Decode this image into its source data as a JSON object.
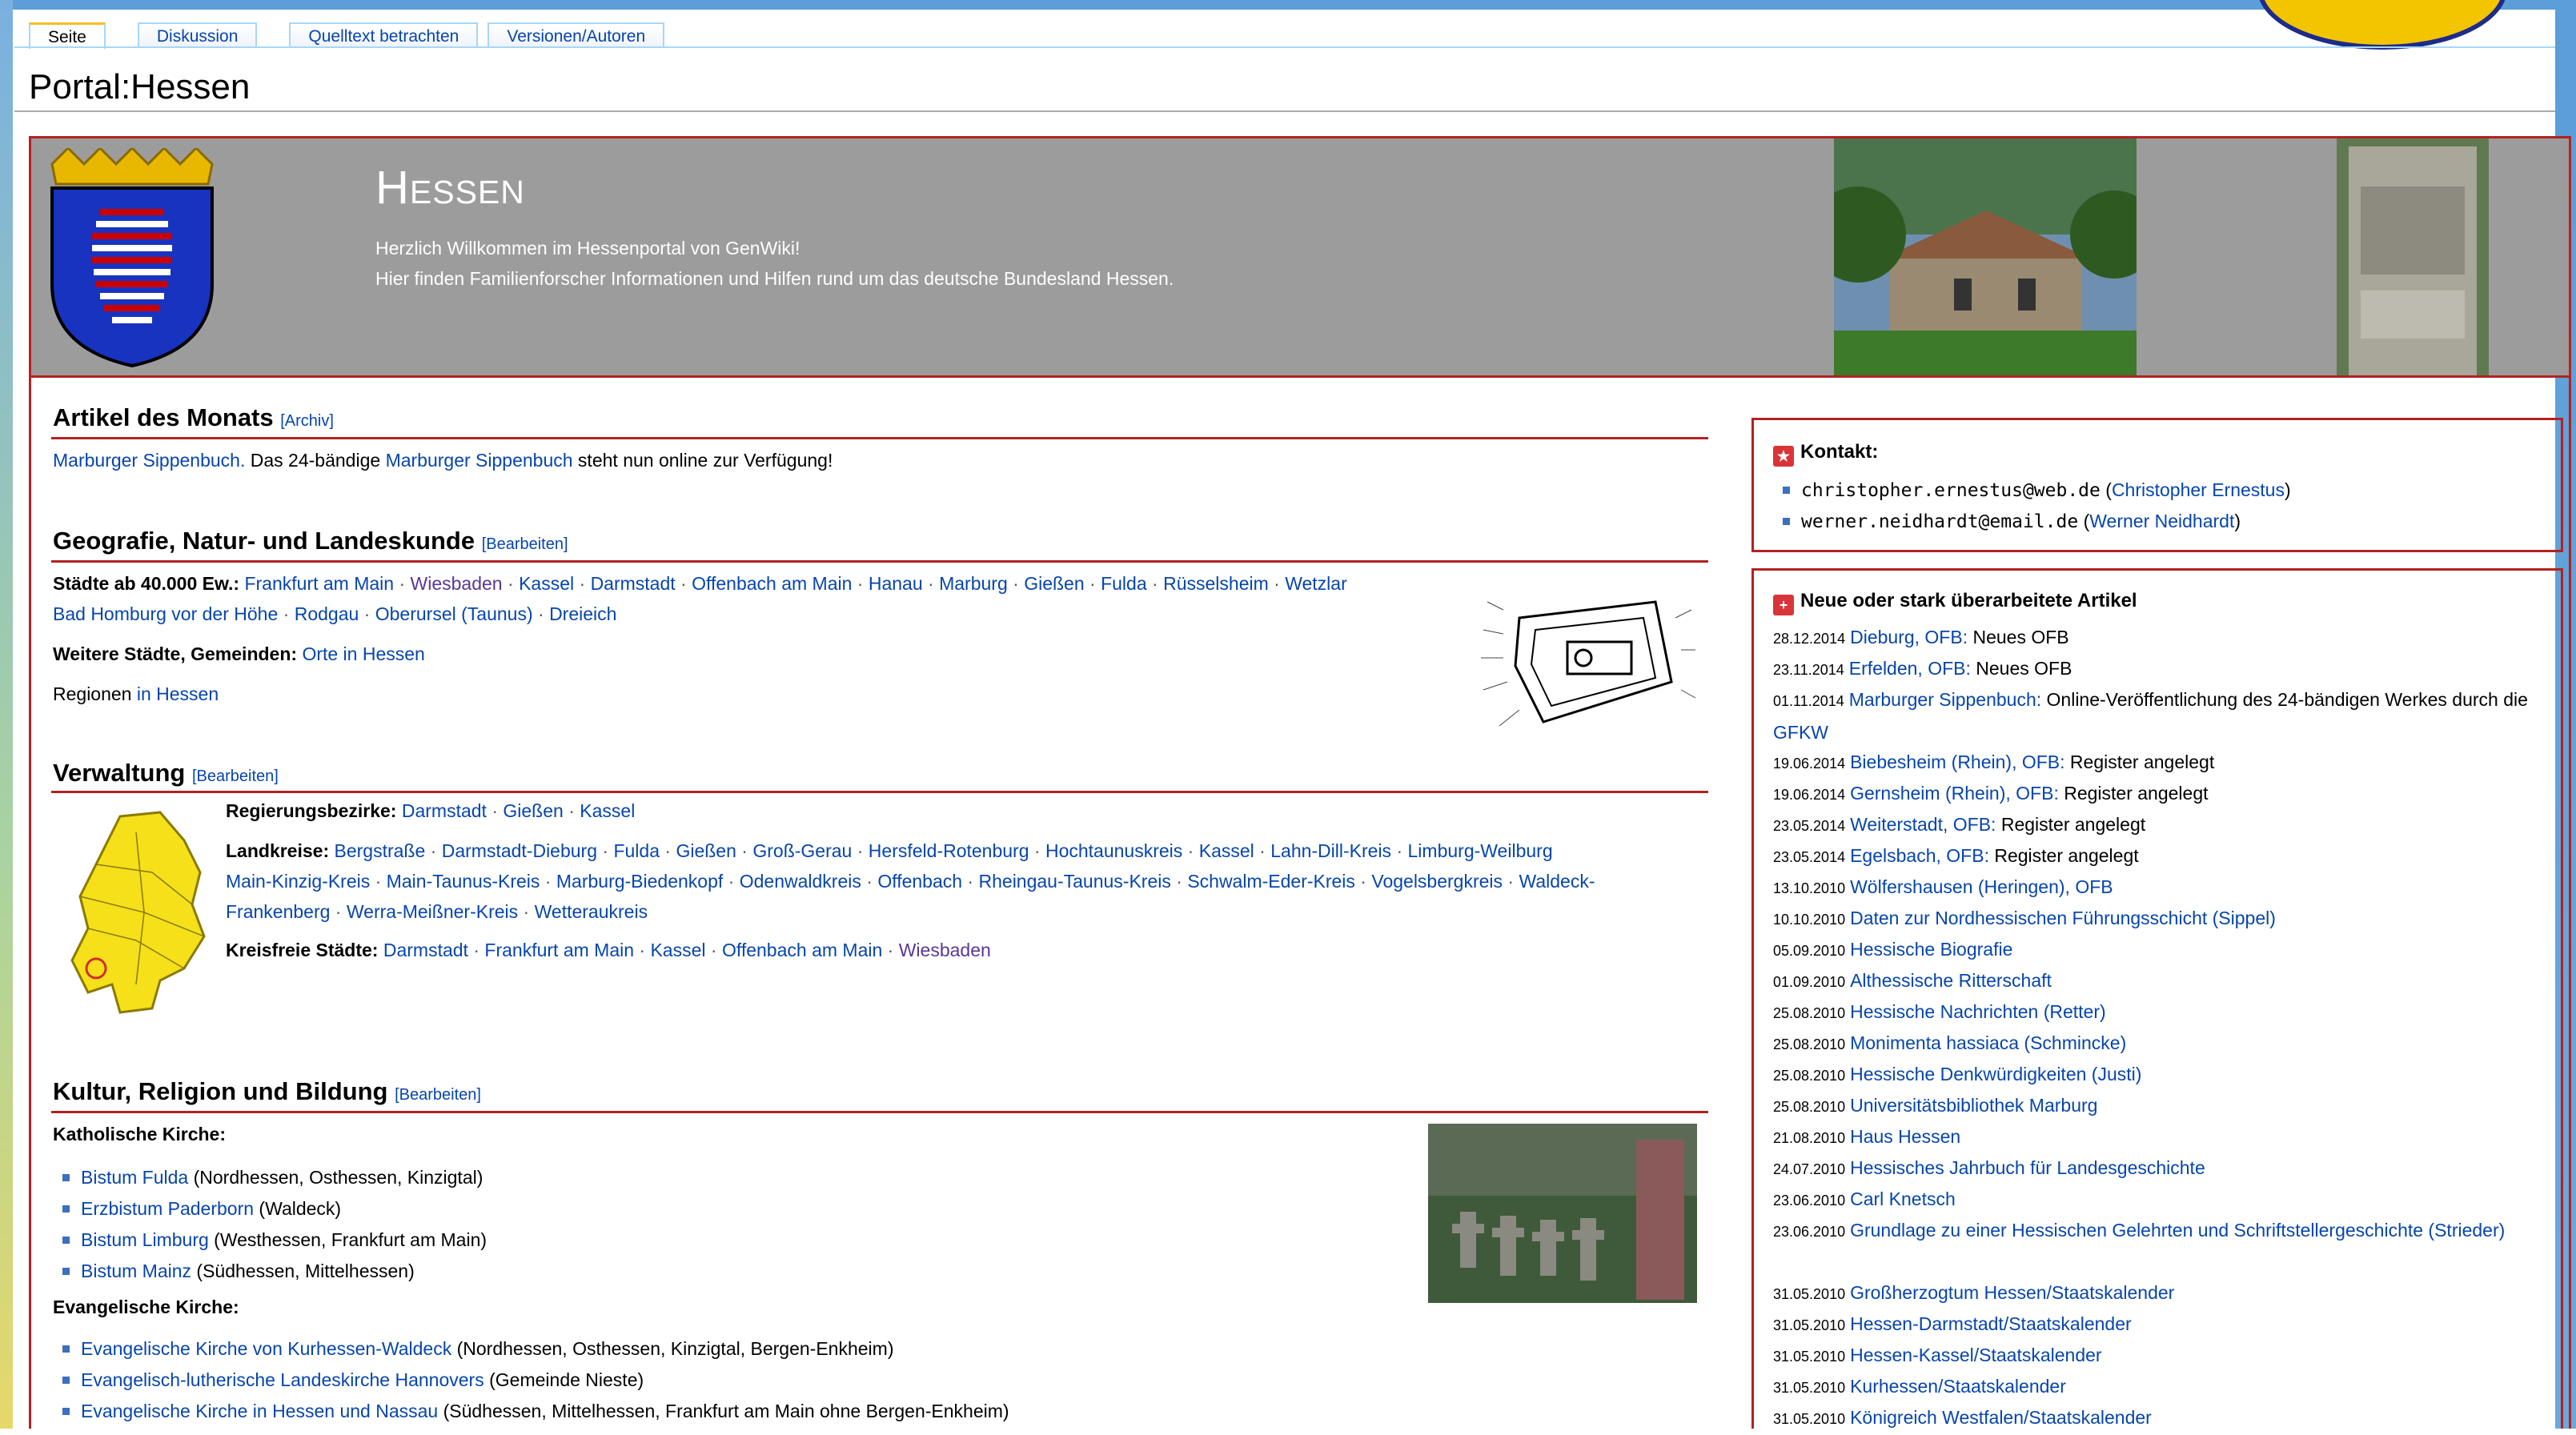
{
  "tabs": [
    "Seite",
    "Diskussion",
    "Quelltext betrachten",
    "Versionen/Autoren"
  ],
  "page_title": "Portal:Hessen",
  "banner": {
    "title": "Hessen",
    "line1": "Herzlich Willkommen im Hessenportal von GenWiki!",
    "line2": "Hier finden Familienforscher Informationen und Hilfen rund um das deutsche Bundesland Hessen."
  },
  "artikel": {
    "heading": "Artikel des Monats",
    "edit": "[Archiv]",
    "link1": "Marburger Sippenbuch.",
    "text1": " Das 24-bändige ",
    "link2": "Marburger Sippenbuch",
    "text2": " steht nun online zur Verfügung!"
  },
  "geo": {
    "heading": "Geografie, Natur- und Landeskunde",
    "edit": "[Bearbeiten]",
    "staedte_label": "Städte ab 40.000 Ew.:",
    "staedte_row1": [
      "Frankfurt am Main",
      "Wiesbaden",
      "Kassel",
      "Darmstadt",
      "Offenbach am Main",
      "Hanau",
      "Marburg",
      "Gießen",
      "Fulda",
      "Rüsselsheim",
      "Wetzlar"
    ],
    "staedte_row2": [
      "Bad Homburg vor der Höhe",
      "Rodgau",
      "Oberursel (Taunus)",
      "Dreieich"
    ],
    "weitere_label": "Weitere Städte, Gemeinden:",
    "weitere_link": "Orte in Hessen",
    "regionen_label": "Regionen",
    "regionen_link": "in Hessen"
  },
  "verwaltung": {
    "heading": "Verwaltung",
    "edit": "[Bearbeiten]",
    "rb_label": "Regierungsbezirke:",
    "rb": [
      "Darmstadt",
      "Gießen",
      "Kassel"
    ],
    "lk_label": "Landkreise:",
    "lk_row1": [
      "Bergstraße",
      "Darmstadt-Dieburg",
      "Fulda",
      "Gießen",
      "Groß-Gerau",
      "Hersfeld-Rotenburg",
      "Hochtaunuskreis",
      "Kassel",
      "Lahn-Dill-Kreis",
      "Limburg-Weilburg"
    ],
    "lk_row2": [
      "Main-Kinzig-Kreis",
      "Main-Taunus-Kreis",
      "Marburg-Biedenkopf",
      "Odenwaldkreis",
      "Offenbach",
      "Rheingau-Taunus-Kreis",
      "Schwalm-Eder-Kreis",
      "Vogelsbergkreis",
      "Waldeck-"
    ],
    "lk_row3": [
      "Frankenberg",
      "Werra-Meißner-Kreis",
      "Wetteraukreis"
    ],
    "ks_label": "Kreisfreie Städte:",
    "ks": [
      "Darmstadt",
      "Frankfurt am Main",
      "Kassel",
      "Offenbach am Main",
      "Wiesbaden"
    ]
  },
  "kultur": {
    "heading": "Kultur, Religion und Bildung",
    "edit": "[Bearbeiten]",
    "kath_label": "Katholische Kirche:",
    "kath": [
      {
        "link": "Bistum Fulda",
        "text": " (Nordhessen, Osthessen, Kinzigtal)"
      },
      {
        "link": "Erzbistum Paderborn",
        "text": " (Waldeck)"
      },
      {
        "link": "Bistum Limburg",
        "text": " (Westhessen, Frankfurt am Main)"
      },
      {
        "link": "Bistum Mainz",
        "text": " (Südhessen, Mittelhessen)"
      }
    ],
    "ev_label": "Evangelische Kirche:",
    "ev": [
      {
        "link": "Evangelische Kirche von Kurhessen-Waldeck",
        "text": " (Nordhessen, Osthessen, Kinzigtal, Bergen-Enkheim)"
      },
      {
        "link": "Evangelisch-lutherische Landeskirche Hannovers",
        "text": " (Gemeinde Nieste)"
      },
      {
        "link": "Evangelische Kirche in Hessen und Nassau",
        "text": " (Südhessen, Mittelhessen, Frankfurt am Main ohne Bergen-Enkheim)"
      }
    ]
  },
  "kontakt": {
    "heading": "Kontakt:",
    "items": [
      {
        "email": "christopher.ernestus@web.de",
        "name": "Christopher Ernestus"
      },
      {
        "email": "werner.neidhardt@email.de",
        "name": "Werner Neidhardt"
      }
    ]
  },
  "neue": {
    "heading": "Neue oder stark überarbeitete Artikel",
    "items": [
      {
        "date": "28.12.2014",
        "link": "Dieburg, OFB:",
        "text": " Neues OFB"
      },
      {
        "date": "23.11.2014",
        "link": "Erfelden, OFB:",
        "text": " Neues OFB"
      },
      {
        "date": "01.11.2014",
        "link": "Marburger Sippenbuch:",
        "text": " Online-Veröffentlichung des 24-bändigen Werkes durch die ",
        "link2": "GFKW"
      },
      {
        "date": "19.06.2014",
        "link": "Biebesheim (Rhein), OFB:",
        "text": " Register angelegt"
      },
      {
        "date": "19.06.2014",
        "link": "Gernsheim (Rhein), OFB:",
        "text": " Register angelegt"
      },
      {
        "date": "23.05.2014",
        "link": "Weiterstadt, OFB:",
        "text": " Register angelegt"
      },
      {
        "date": "23.05.2014",
        "link": "Egelsbach, OFB:",
        "text": " Register angelegt"
      },
      {
        "date": "13.10.2010",
        "link": "Wölfershausen (Heringen), OFB",
        "text": ""
      },
      {
        "date": "10.10.2010",
        "link": "Daten zur Nordhessischen Führungsschicht (Sippel)",
        "text": ""
      },
      {
        "date": "05.09.2010",
        "link": "Hessische Biografie",
        "text": ""
      },
      {
        "date": "01.09.2010",
        "link": "Althessische Ritterschaft",
        "text": ""
      },
      {
        "date": "25.08.2010",
        "link": "Hessische Nachrichten (Retter)",
        "text": ""
      },
      {
        "date": "25.08.2010",
        "link": "Monimenta hassiaca (Schmincke)",
        "text": ""
      },
      {
        "date": "25.08.2010",
        "link": "Hessische Denkwürdigkeiten (Justi)",
        "text": ""
      },
      {
        "date": "25.08.2010",
        "link": "Universitätsbibliothek Marburg",
        "text": ""
      },
      {
        "date": "21.08.2010",
        "link": "Haus Hessen",
        "text": ""
      },
      {
        "date": "24.07.2010",
        "link": "Hessisches Jahrbuch für Landesgeschichte",
        "text": ""
      },
      {
        "date": "23.06.2010",
        "link": "Carl Knetsch",
        "text": ""
      },
      {
        "date": "23.06.2010",
        "link": "Grundlage zu einer Hessischen Gelehrten und Schriftstellergeschichte (Strieder)",
        "text": ""
      },
      {
        "date": "31.05.2010",
        "link": "Großherzogtum Hessen/Staatskalender",
        "text": ""
      },
      {
        "date": "31.05.2010",
        "link": "Hessen-Darmstadt/Staatskalender",
        "text": ""
      },
      {
        "date": "31.05.2010",
        "link": "Hessen-Kassel/Staatskalender",
        "text": ""
      },
      {
        "date": "31.05.2010",
        "link": "Kurhessen/Staatskalender",
        "text": ""
      },
      {
        "date": "31.05.2010",
        "link": "Königreich Westfalen/Staatskalender",
        "text": ""
      }
    ]
  }
}
